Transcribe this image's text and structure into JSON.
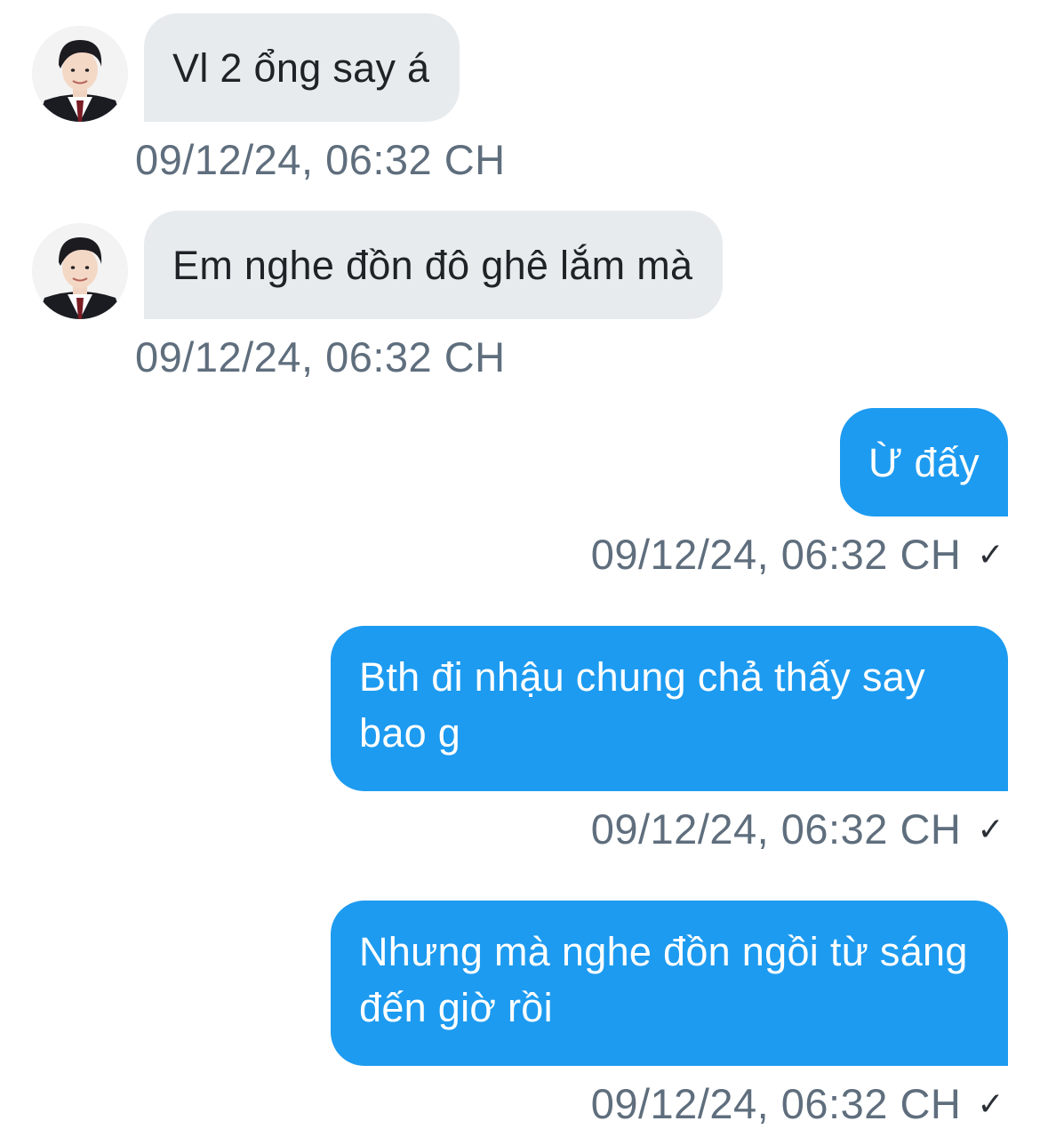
{
  "conversation": {
    "messages": [
      {
        "direction": "incoming",
        "text": "Vl 2 ổng say á",
        "timestamp": "09/12/24, 06:32 CH"
      },
      {
        "direction": "incoming",
        "text": "Em nghe đồn đô ghê lắm mà",
        "timestamp": "09/12/24, 06:32 CH"
      },
      {
        "direction": "outgoing",
        "text": "Ừ đấy",
        "timestamp": "09/12/24, 06:32 CH",
        "status_icon": "✓"
      },
      {
        "direction": "outgoing",
        "text": "Bth đi nhậu chung chả thấy say bao g",
        "timestamp": "09/12/24, 06:32 CH",
        "status_icon": "✓"
      },
      {
        "direction": "outgoing",
        "text": "Nhưng mà nghe đồn ngồi từ sáng đến giờ rồi",
        "timestamp": "09/12/24, 06:32 CH",
        "status_icon": "✓"
      }
    ]
  },
  "colors": {
    "incoming_bubble": "#e8ebee",
    "outgoing_bubble": "#1d9bf0",
    "timestamp_text": "#5f6e7d"
  }
}
